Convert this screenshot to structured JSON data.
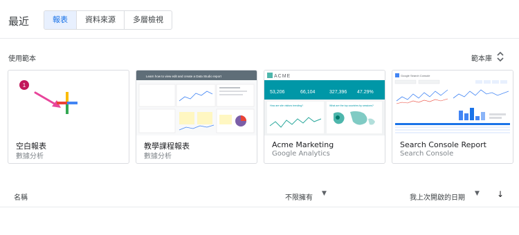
{
  "header": {
    "title": "最近",
    "tabs": [
      {
        "label": "報表",
        "active": true
      },
      {
        "label": "資料來源",
        "active": false
      },
      {
        "label": "多層檢視",
        "active": false
      }
    ]
  },
  "templates": {
    "section_label": "使用範本",
    "library_label": "範本庫",
    "cards": [
      {
        "name": "空白報表",
        "source": "數據分析"
      },
      {
        "name": "教學課程報表",
        "source": "數據分析",
        "thumb_title": "Learn how to view edit and create a Data Studio report"
      },
      {
        "name": "Acme Marketing",
        "source": "Google Analytics",
        "brand": "ACME",
        "kpis": [
          "53,206",
          "66,104",
          "327,396",
          "47.29%"
        ],
        "q1": "How are site visitors trending?",
        "q2": "What are the top countries by sessions?"
      },
      {
        "name": "Search Console Report",
        "source": "Search Console",
        "thumb_title": "Google Search Console"
      }
    ],
    "step_badge": "1"
  },
  "list": {
    "col_name": "名稱",
    "col_owner": "不限擁有",
    "col_date": "我上次開啟的日期"
  },
  "colors": {
    "accent": "#1a73e8",
    "plus_red": "#ea4335",
    "plus_yellow": "#fbbc04",
    "plus_green": "#34a853",
    "plus_blue": "#4285f4",
    "arrow": "#e8459b"
  }
}
